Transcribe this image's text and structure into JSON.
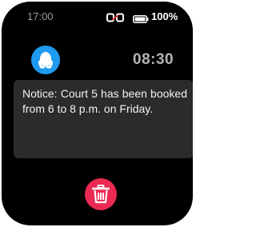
{
  "status_bar": {
    "time": "17:00",
    "battery_percent": "100%",
    "battery_level": 1.0,
    "connection_icon": "link-icon"
  },
  "app": {
    "icon": "qq-penguin-icon",
    "icon_color": "#1e9bf0"
  },
  "clock": {
    "time": "08:30"
  },
  "notification": {
    "message": "Notice: Court 5 has been booked from 6 to 8 p.m.  on Friday."
  },
  "actions": {
    "delete_icon": "trash-icon",
    "delete_color": "#ea2a52"
  }
}
